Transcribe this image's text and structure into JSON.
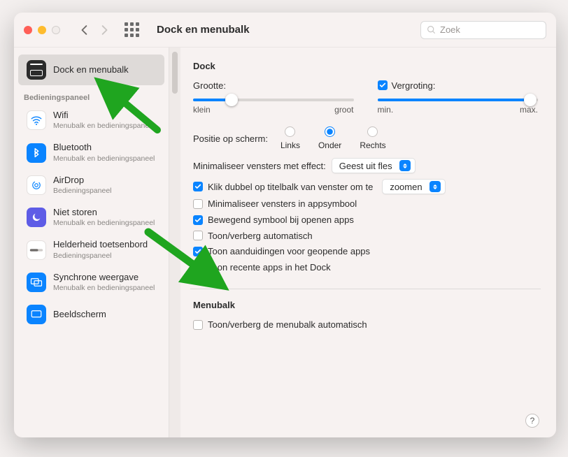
{
  "toolbar": {
    "title": "Dock en menubalk",
    "search_placeholder": "Zoek"
  },
  "sidebar": {
    "primary": {
      "label": "Dock en menubalk"
    },
    "group_label": "Bedieningspaneel",
    "items": [
      {
        "label": "Wifi",
        "sub": "Menubalk en bedieningspaneel",
        "icon": "wifi"
      },
      {
        "label": "Bluetooth",
        "sub": "Menubalk en bedieningspaneel",
        "icon": "bt"
      },
      {
        "label": "AirDrop",
        "sub": "Bedieningspaneel",
        "icon": "ad"
      },
      {
        "label": "Niet storen",
        "sub": "Menubalk en bedieningspaneel",
        "icon": "dnd"
      },
      {
        "label": "Helderheid toetsenbord",
        "sub": "Bedieningspaneel",
        "icon": "bright"
      },
      {
        "label": "Synchrone weergave",
        "sub": "Menubalk en bedieningspaneel",
        "icon": "mirror"
      },
      {
        "label": "Beeldscherm",
        "sub": "",
        "icon": "screen"
      }
    ]
  },
  "content": {
    "dock_title": "Dock",
    "size_label": "Grootte:",
    "size_min": "klein",
    "size_max": "groot",
    "mag_label": "Vergroting:",
    "mag_min": "min.",
    "mag_max": "max.",
    "pos_label": "Positie op scherm:",
    "pos_left": "Links",
    "pos_center": "Onder",
    "pos_right": "Rechts",
    "effect_label": "Minimaliseer vensters met effect:",
    "effect_value": "Geest uit fles",
    "dblclick_prefix": "Klik dubbel op titelbalk van venster om te",
    "dblclick_value": "zoomen",
    "min_into_icon": "Minimaliseer vensters in appsymbool",
    "animate_open": "Bewegend symbool bij openen apps",
    "autohide": "Toon/verberg automatisch",
    "indicators": "Toon aanduidingen voor geopende apps",
    "recent": "Toon recente apps in het Dock",
    "menubar_title": "Menubalk",
    "menubar_autohide": "Toon/verberg de menubalk automatisch",
    "checks": {
      "mag": true,
      "dblclick": true,
      "min_into_icon": false,
      "animate_open": true,
      "autohide": false,
      "indicators": true,
      "recent": true,
      "menubar_autohide": false
    },
    "size_pct": 24,
    "mag_pct": 95
  }
}
